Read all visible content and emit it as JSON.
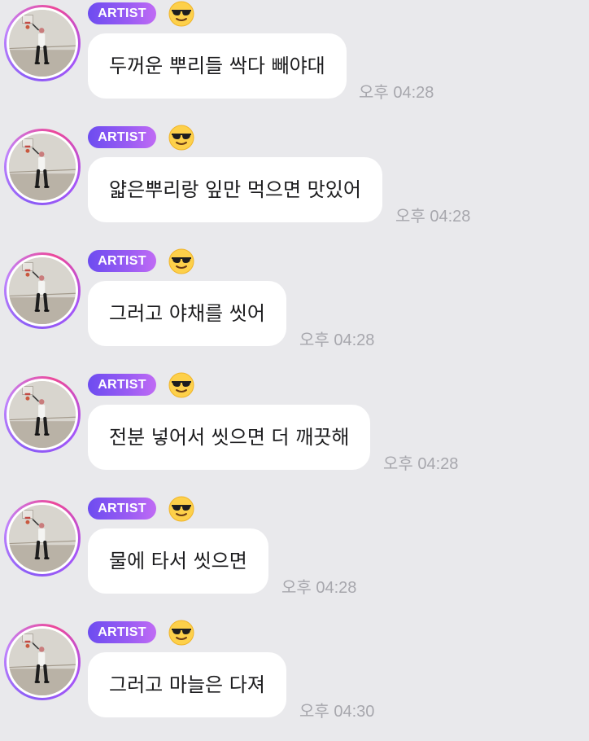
{
  "messages": [
    {
      "badge": "ARTIST",
      "emoji": "😎",
      "text": "두꺼운 뿌리들 싹다 빼야대",
      "time": "오후 04:28"
    },
    {
      "badge": "ARTIST",
      "emoji": "😎",
      "text": "얇은뿌리랑 잎만 먹으면 맛있어",
      "time": "오후 04:28"
    },
    {
      "badge": "ARTIST",
      "emoji": "😎",
      "text": "그러고 야채를 씻어",
      "time": "오후 04:28"
    },
    {
      "badge": "ARTIST",
      "emoji": "😎",
      "text": "전분 넣어서 씻으면 더 깨끗해",
      "time": "오후 04:28"
    },
    {
      "badge": "ARTIST",
      "emoji": "😎",
      "text": "물에 타서 씻으면",
      "time": "오후 04:28"
    },
    {
      "badge": "ARTIST",
      "emoji": "😎",
      "text": "그러고 마늘은 다져",
      "time": "오후 04:30"
    }
  ],
  "colors": {
    "background": "#e9e9ec",
    "bubble": "#ffffff",
    "badge_start": "#6d4cf0",
    "badge_end": "#c06bf4",
    "timestamp": "#a7a7ad",
    "avatar_ring": "#a855f7"
  },
  "icons": {
    "badge_emoji": "smiling-face-with-sunglasses-icon",
    "avatar": "artist-profile-photo"
  }
}
